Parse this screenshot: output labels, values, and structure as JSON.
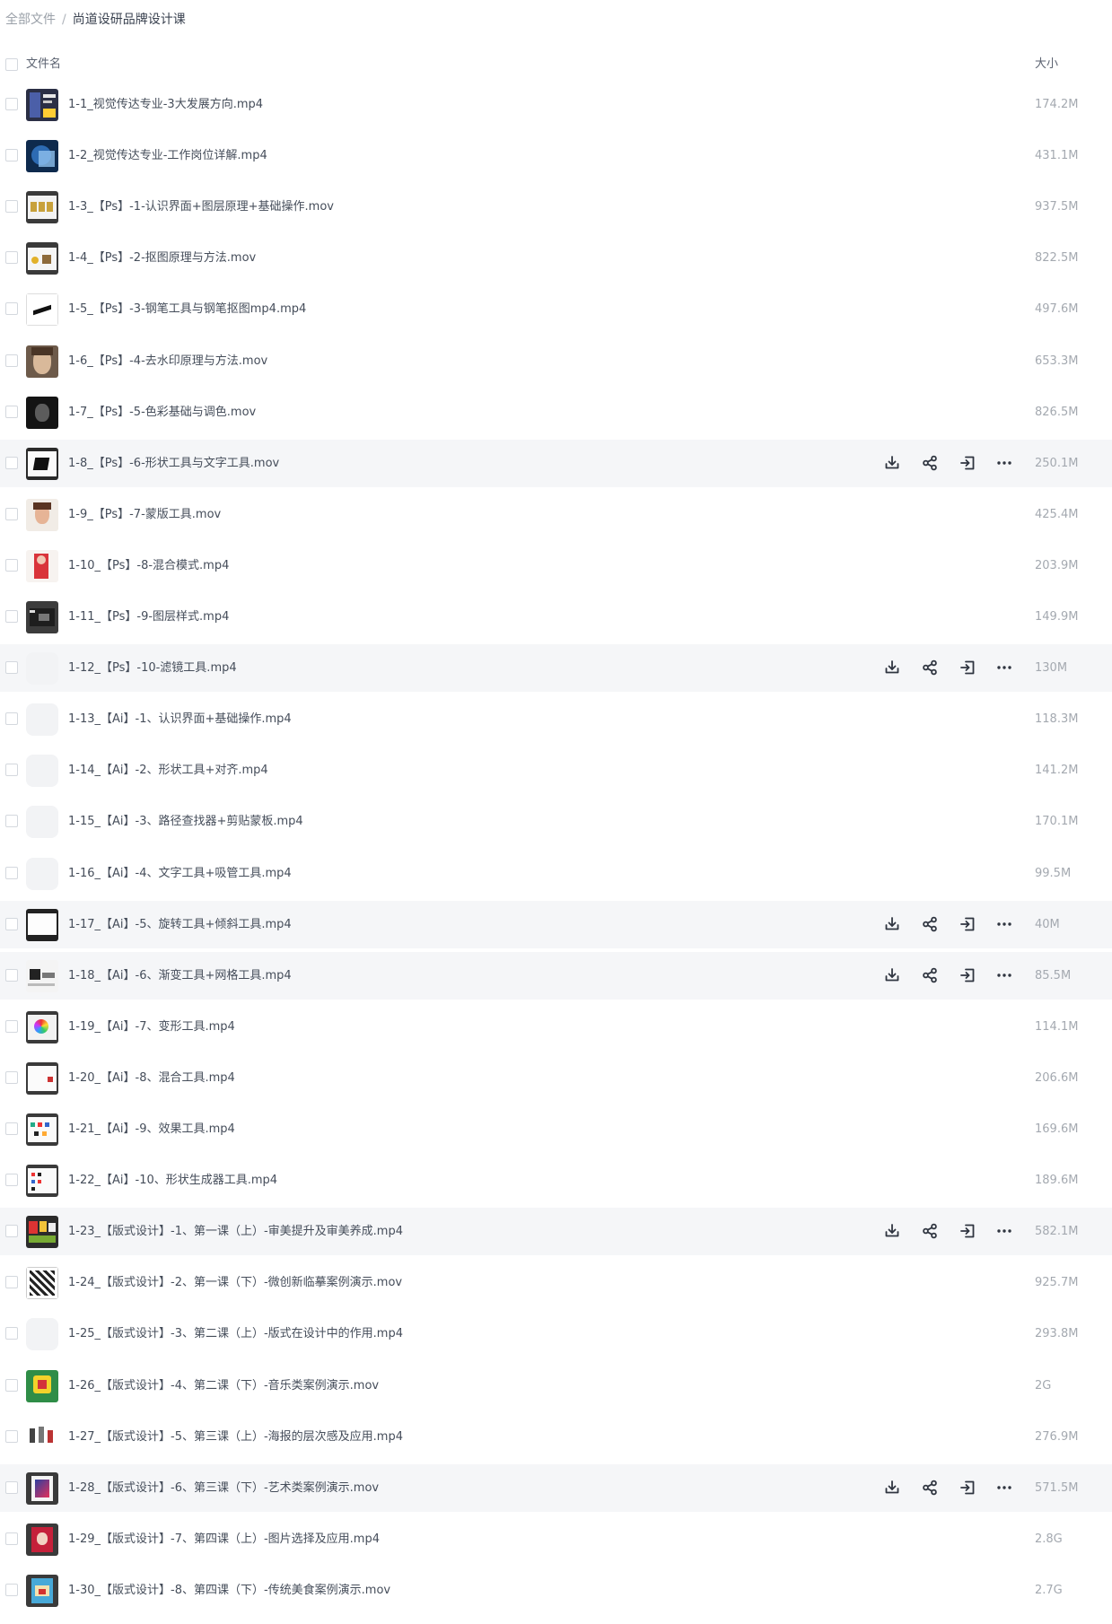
{
  "breadcrumb": {
    "root": "全部文件",
    "separator": "/",
    "current": "尚道设研品牌设计课"
  },
  "header": {
    "name_label": "文件名",
    "size_label": "大小"
  },
  "files": [
    {
      "name": "1-1_视觉传达专业-3大发展方向.mp4",
      "size": "174.2M",
      "hover": false
    },
    {
      "name": "1-2_视觉传达专业-工作岗位详解.mp4",
      "size": "431.1M",
      "hover": false
    },
    {
      "name": "1-3_【Ps】-1-认识界面+图层原理+基础操作.mov",
      "size": "937.5M",
      "hover": false
    },
    {
      "name": "1-4_【Ps】-2-抠图原理与方法.mov",
      "size": "822.5M",
      "hover": false
    },
    {
      "name": "1-5_【Ps】-3-钢笔工具与钢笔抠图mp4.mp4",
      "size": "497.6M",
      "hover": false
    },
    {
      "name": "1-6_【Ps】-4-去水印原理与方法.mov",
      "size": "653.3M",
      "hover": false
    },
    {
      "name": "1-7_【Ps】-5-色彩基础与调色.mov",
      "size": "826.5M",
      "hover": false
    },
    {
      "name": "1-8_【Ps】-6-形状工具与文字工具.mov",
      "size": "250.1M",
      "hover": true
    },
    {
      "name": "1-9_【Ps】-7-蒙版工具.mov",
      "size": "425.4M",
      "hover": false
    },
    {
      "name": "1-10_【Ps】-8-混合模式.mp4",
      "size": "203.9M",
      "hover": false
    },
    {
      "name": "1-11_【Ps】-9-图层样式.mp4",
      "size": "149.9M",
      "hover": false
    },
    {
      "name": "1-12_【Ps】-10-滤镜工具.mp4",
      "size": "130M",
      "hover": true
    },
    {
      "name": "1-13_【Ai】-1、认识界面+基础操作.mp4",
      "size": "118.3M",
      "hover": false
    },
    {
      "name": "1-14_【Ai】-2、形状工具+对齐.mp4",
      "size": "141.2M",
      "hover": false
    },
    {
      "name": "1-15_【Ai】-3、路径查找器+剪贴蒙板.mp4",
      "size": "170.1M",
      "hover": false
    },
    {
      "name": "1-16_【Ai】-4、文字工具+吸管工具.mp4",
      "size": "99.5M",
      "hover": false
    },
    {
      "name": "1-17_【Ai】-5、旋转工具+倾斜工具.mp4",
      "size": "40M",
      "hover": true
    },
    {
      "name": "1-18_【Ai】-6、渐变工具+网格工具.mp4",
      "size": "85.5M",
      "hover": true
    },
    {
      "name": "1-19_【Ai】-7、变形工具.mp4",
      "size": "114.1M",
      "hover": false
    },
    {
      "name": "1-20_【Ai】-8、混合工具.mp4",
      "size": "206.6M",
      "hover": false
    },
    {
      "name": "1-21_【Ai】-9、效果工具.mp4",
      "size": "169.6M",
      "hover": false
    },
    {
      "name": "1-22_【Ai】-10、形状生成器工具.mp4",
      "size": "189.6M",
      "hover": false
    },
    {
      "name": "1-23_【版式设计】-1、第一课（上）-审美提升及审美养成.mp4",
      "size": "582.1M",
      "hover": true
    },
    {
      "name": "1-24_【版式设计】-2、第一课（下）-微创新临摹案例演示.mov",
      "size": "925.7M",
      "hover": false
    },
    {
      "name": "1-25_【版式设计】-3、第二课（上）-版式在设计中的作用.mp4",
      "size": "293.8M",
      "hover": false
    },
    {
      "name": "1-26_【版式设计】-4、第二课（下）-音乐类案例演示.mov",
      "size": "2G",
      "hover": false
    },
    {
      "name": "1-27_【版式设计】-5、第三课（上）-海报的层次感及应用.mp4",
      "size": "276.9M",
      "hover": false
    },
    {
      "name": "1-28_【版式设计】-6、第三课（下）-艺术类案例演示.mov",
      "size": "571.5M",
      "hover": true
    },
    {
      "name": "1-29_【版式设计】-7、第四课（上）-图片选择及应用.mp4",
      "size": "2.8G",
      "hover": false
    },
    {
      "name": "1-30_【版式设计】-8、第四课（下）-传统美食案例演示.mov",
      "size": "2.7G",
      "hover": false
    }
  ],
  "action_icons": [
    "download-icon",
    "share-icon",
    "move-icon",
    "more-icon"
  ],
  "colors": {
    "hover_row": "#f5f6f8",
    "text": "#454d5a",
    "muted": "#a4a9b0",
    "icon": "#2f3540"
  }
}
